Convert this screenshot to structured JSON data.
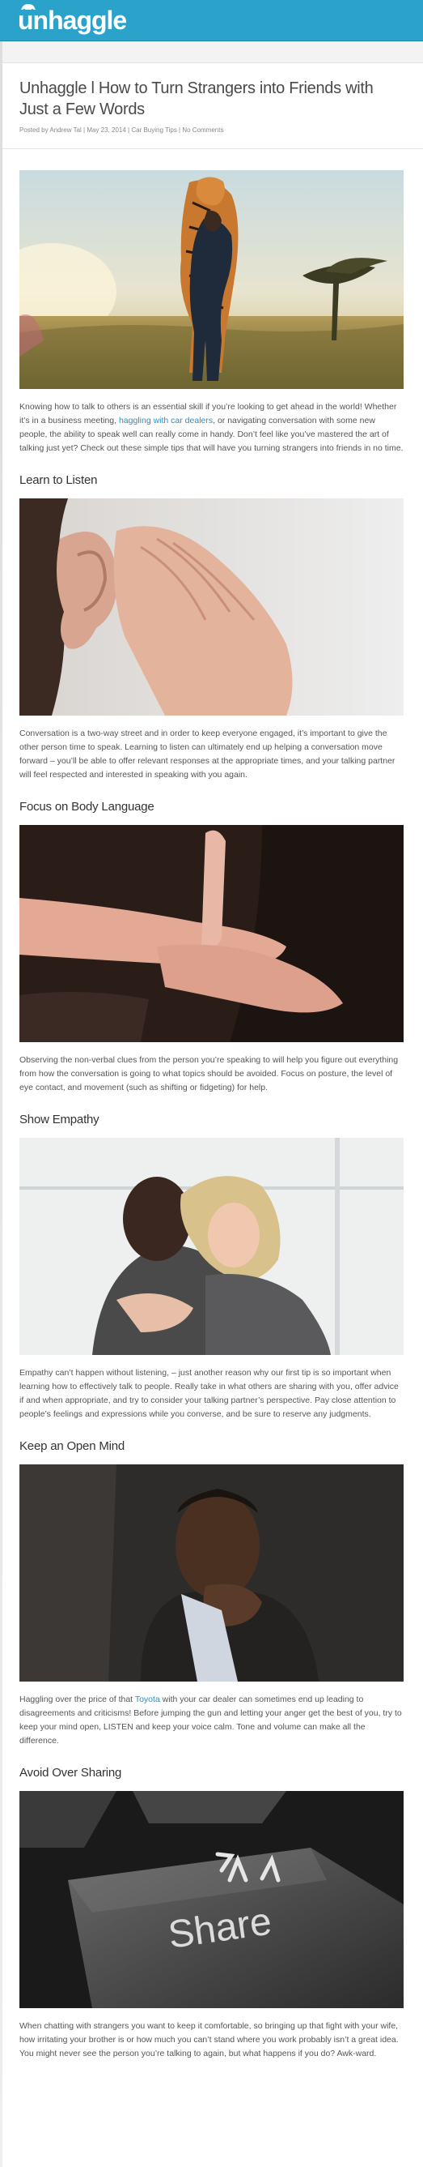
{
  "site": {
    "logo": "unhaggle"
  },
  "article": {
    "title": "Unhaggle l How to Turn Strangers into Friends with Just a Few Words",
    "meta": {
      "posted_by": "Posted by Andrew Tal",
      "date": "May 23, 2014",
      "category": "Car Buying Tips",
      "comments": "No Comments"
    },
    "intro": {
      "part1": "Knowing how to talk to others is an essential skill if you’re looking to get ahead in the world! Whether it’s in a business meeting, ",
      "link": "haggling with car dealers",
      "part2": ", or navigating conversation with some new people, the ability to speak well can really come in handy. Don’t feel like you’ve mastered the art of talking just yet? Check out these simple tips that will have you turning strangers into friends in no time."
    },
    "sections": [
      {
        "heading": "Learn to Listen",
        "text": "Conversation is a two-way street and in order to keep everyone engaged, it’s important to give the other person time to speak. Learning to listen can ultimately end up helping a conversation move forward – you’ll be able to offer relevant responses at the appropriate times, and your talking partner will feel respected and interested in speaking with you again."
      },
      {
        "heading": "Focus on Body Language",
        "text": "Observing the non-verbal clues from the person you’re speaking to will help you figure out everything from how the conversation is going to what topics should be avoided.  Focus on posture, the level of eye contact, and movement (such as shifting or fidgeting) for help."
      },
      {
        "heading": "Show Empathy",
        "text": "Empathy can’t happen without listening, – just another reason why our first tip is so important when learning how to effectively talk to people. Really take in what others are sharing with you, offer advice if and when appropriate, and try to consider your talking partner’s perspective. Pay close attention to people’s feelings and expressions while you converse, and be sure to reserve any judgments."
      },
      {
        "heading": "Keep an Open Mind",
        "text_part1": "Haggling over the price of that ",
        "link": "Toyota",
        "text_part2": " with your car dealer can sometimes end up leading to disagreements and criticisms! Before jumping the gun and letting your anger get the best of you, try to keep your mind open, LISTEN and keep your voice calm. Tone and volume can make all the difference."
      },
      {
        "heading": "Avoid Over Sharing",
        "image_text": "Share",
        "text": "When chatting with strangers you want to keep it comfortable, so bringing up that fight with your wife, how irritating your brother is or how much you can’t stand where you work probably isn’t a great idea. You might never see the person you’re talking to again, but what happens if you do? Awk-ward."
      }
    ]
  }
}
